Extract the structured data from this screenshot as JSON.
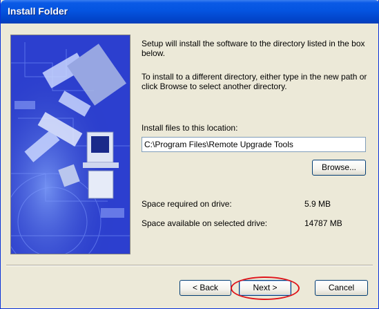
{
  "window": {
    "title": "Install Folder"
  },
  "content": {
    "description_1": "Setup will install the software to the directory listed in the box below.",
    "description_2": "To install to a different directory, either type in the new path or click Browse to select another directory.",
    "install_label": "Install files to this location:",
    "install_path": "C:\\Program Files\\Remote Upgrade Tools",
    "browse_label": "Browse...",
    "space_required_label": "Space required on drive:",
    "space_required_value": "5.9 MB",
    "space_available_label": "Space available on selected drive:",
    "space_available_value": "14787 MB"
  },
  "footer": {
    "back_label": "< Back",
    "next_label": "Next >",
    "cancel_label": "Cancel"
  },
  "colors": {
    "titlebar": "#0454e0",
    "highlight_ring": "#e0141a",
    "dialog_background": "#ece9d8"
  },
  "icons": {
    "banner_art": "circuit-board-image"
  }
}
